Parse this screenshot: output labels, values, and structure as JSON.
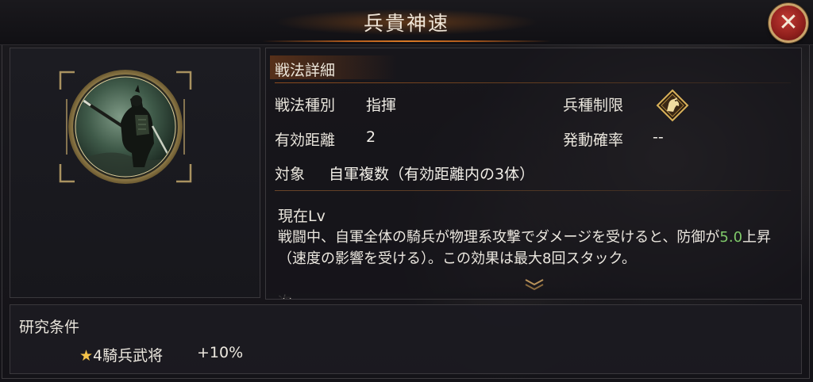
{
  "window": {
    "title": "兵貴神速",
    "close_icon": "close-x-icon"
  },
  "portrait": {
    "icon": "cavalry-warrior-portrait"
  },
  "details": {
    "section_title": "戦法詳細",
    "type_label": "戦法種別",
    "type_value": "指揮",
    "troop_restriction_label": "兵種制限",
    "troop_restriction_icon": "cavalry-horse-icon",
    "range_label": "有効距離",
    "range_value": "2",
    "activation_rate_label": "発動確率",
    "activation_rate_value": "--",
    "target_label": "対象",
    "target_value": "自軍複数（有効距離内の3体）"
  },
  "effect": {
    "level_label": "現在Lv",
    "text_part1": "戦闘中、自軍全体の騎兵が物理系攻撃でダメージを受けると、防御が",
    "highlight_value": "5.0",
    "text_part2": "上昇（速度の影響を受ける）。この効果は最大8回スタック。",
    "next_cut": "次"
  },
  "research": {
    "title": "研究条件",
    "star": "★",
    "condition": "4騎兵武将",
    "bonus": "+10%"
  },
  "colors": {
    "highlight": "#7fc96a",
    "accent_orange": "#d97a26",
    "gold_frame": "#c9a36a",
    "close_red": "#a62a25"
  }
}
